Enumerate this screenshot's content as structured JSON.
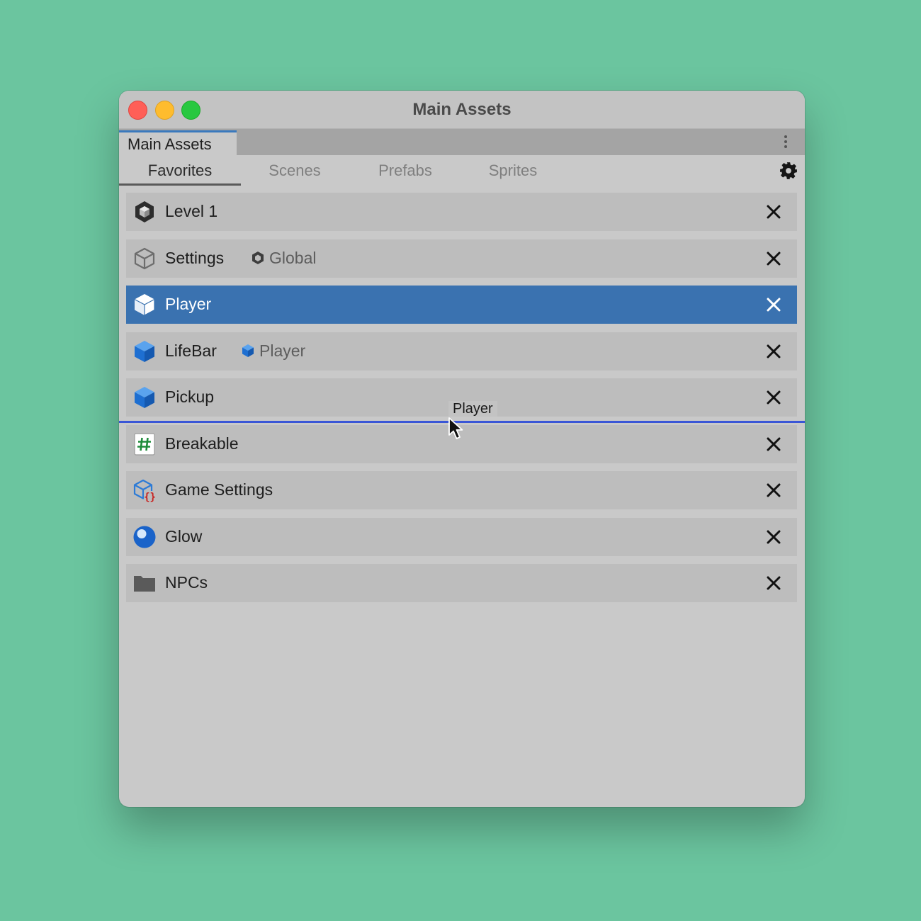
{
  "window": {
    "title": "Main Assets"
  },
  "doc_tab": {
    "label": "Main Assets"
  },
  "subtabs": [
    {
      "label": "Favorites",
      "active": true
    },
    {
      "label": "Scenes",
      "active": false
    },
    {
      "label": "Prefabs",
      "active": false
    },
    {
      "label": "Sprites",
      "active": false
    }
  ],
  "items": [
    {
      "label": "Level 1",
      "icon": "unity-scene-icon"
    },
    {
      "label": "Settings",
      "icon": "gray-cube-icon",
      "ref": "Global",
      "ref_icon": "small-gray-cube-icon"
    },
    {
      "label": "Player",
      "icon": "white-cube-icon",
      "selected": true
    },
    {
      "label": "LifeBar",
      "icon": "blue-cube-icon",
      "ref": "Player",
      "ref_icon": "small-blue-cube-icon"
    },
    {
      "label": "Pickup",
      "icon": "blue-cube-icon"
    },
    {
      "label": "Breakable",
      "icon": "script-hash-icon"
    },
    {
      "label": "Game Settings",
      "icon": "scriptable-object-icon"
    },
    {
      "label": "Glow",
      "icon": "material-sphere-icon"
    },
    {
      "label": "NPCs",
      "icon": "folder-icon"
    }
  ],
  "drag": {
    "label": "Player"
  },
  "colors": {
    "selection": "#3a72b0",
    "drop_indicator": "#3a56d6",
    "desktop": "#6bc59f"
  }
}
